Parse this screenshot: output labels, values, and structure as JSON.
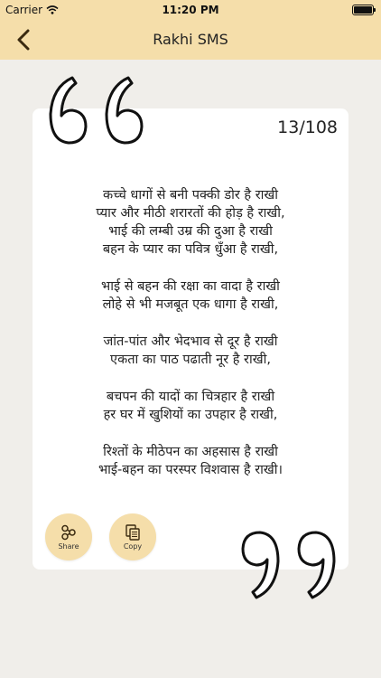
{
  "status_bar": {
    "carrier": "Carrier",
    "time": "11:20 PM"
  },
  "nav": {
    "title": "Rakhi SMS"
  },
  "message": {
    "counter": "13/108",
    "stanzas": [
      [
        "कच्चे धागों से बनी पक्की डोर है राखी",
        "प्यार और मीठी शरारतों की होड़ है राखी,",
        "भाई की लम्बी उम्र की दुआ है राखी",
        "बहन के प्यार का पवित्र धुँआ है राखी,"
      ],
      [
        "भाई से बहन की रक्षा का वादा है राखी",
        "लोहे से भी मजबूत एक धागा है राखी,"
      ],
      [
        "जांत-पांत और भेदभाव से दूर है राखी",
        "एकता का पाठ पढाती नूर है राखी,"
      ],
      [
        "बचपन की यादों का चित्रहार है राखी",
        "हर घर में खुशियों का उपहार है राखी,"
      ],
      [
        "रिश्तों के मीठेपन का अहसास है राखी",
        "भाई-बहन का परस्पर विशवास है राखी।"
      ]
    ]
  },
  "actions": {
    "share_label": "Share",
    "copy_label": "Copy"
  },
  "colors": {
    "accent": "#f5deaa",
    "background": "#f0eeea",
    "card": "#ffffff",
    "text": "#222222"
  },
  "icons": {
    "back": "chevron-left-icon",
    "share": "share-nodes-icon",
    "copy": "copy-documents-icon",
    "wifi": "wifi-icon",
    "battery": "battery-icon"
  }
}
